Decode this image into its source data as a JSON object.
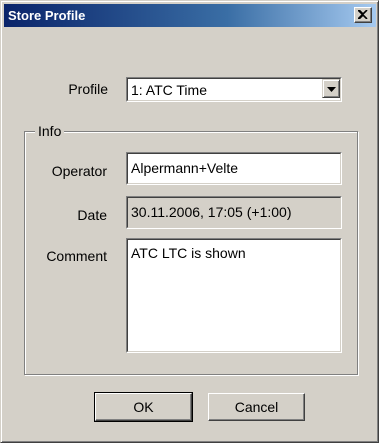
{
  "window": {
    "title": "Store Profile"
  },
  "profile": {
    "label": "Profile",
    "selected": "1: ATC Time"
  },
  "info": {
    "legend": "Info",
    "operator_label": "Operator",
    "operator_value": "Alpermann+Velte",
    "date_label": "Date",
    "date_value": "30.11.2006, 17:05 (+1:00)",
    "comment_label": "Comment",
    "comment_value": "ATC LTC is shown"
  },
  "buttons": {
    "ok": "OK",
    "cancel": "Cancel"
  },
  "icons": {
    "close": "close-icon",
    "dropdown": "chevron-down-icon"
  }
}
